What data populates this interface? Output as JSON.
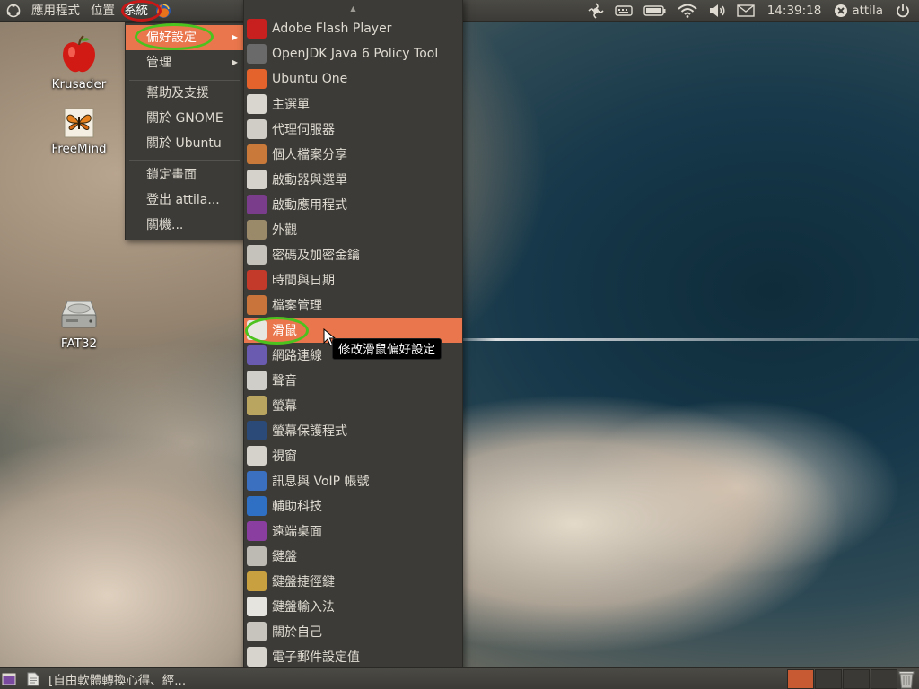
{
  "top_panel": {
    "menus": [
      {
        "label": "應用程式"
      },
      {
        "label": "位置"
      },
      {
        "label": "系統"
      }
    ],
    "clock": "14:39:18",
    "user": "attila",
    "indicators": [
      "touch-indicator-icon",
      "keyboard-icon",
      "battery-icon",
      "wifi-icon",
      "volume-icon",
      "mail-icon",
      "user-status-icon",
      "power-icon"
    ]
  },
  "desktop": {
    "icons": [
      {
        "label": "Krusader",
        "icon": "krusader-apple-icon"
      },
      {
        "label": "FreeMind",
        "icon": "freemind-butterfly-icon"
      },
      {
        "label": "FAT32",
        "icon": "drive-icon"
      }
    ]
  },
  "system_menu": {
    "items": [
      {
        "label": "偏好設定",
        "submenu": true,
        "active": true
      },
      {
        "label": "管理",
        "submenu": true
      },
      {
        "label": "幫助及支援"
      },
      {
        "label": "關於 GNOME"
      },
      {
        "label": "關於 Ubuntu"
      },
      {
        "label": "鎖定畫面"
      },
      {
        "label": "登出 attila..."
      },
      {
        "label": "關機..."
      }
    ]
  },
  "preferences_menu": {
    "items": [
      {
        "label": "Adobe Flash Player",
        "icon": "flash-icon",
        "color": "#c8201e"
      },
      {
        "label": "OpenJDK Java 6 Policy Tool",
        "icon": "java-icon",
        "color": "#6a6a6a"
      },
      {
        "label": "Ubuntu One",
        "icon": "ubuntu-one-icon",
        "color": "#e4622b"
      },
      {
        "label": "主選單",
        "icon": "main-menu-icon",
        "color": "#d8d6cf"
      },
      {
        "label": "代理伺服器",
        "icon": "proxy-icon",
        "color": "#cfcdc6"
      },
      {
        "label": "個人檔案分享",
        "icon": "file-share-icon",
        "color": "#c97a3a"
      },
      {
        "label": "啟動器與選單",
        "icon": "launcher-icon",
        "color": "#d4d2cb"
      },
      {
        "label": "啟動應用程式",
        "icon": "startup-apps-icon",
        "color": "#7a3d8c"
      },
      {
        "label": "外觀",
        "icon": "appearance-icon",
        "color": "#9a8a6a"
      },
      {
        "label": "密碼及加密金鑰",
        "icon": "keys-icon",
        "color": "#c4c2bb"
      },
      {
        "label": "時間與日期",
        "icon": "clock-calendar-icon",
        "color": "#c33a2a"
      },
      {
        "label": "檔案管理",
        "icon": "file-manager-icon",
        "color": "#c9743a"
      },
      {
        "label": "滑鼠",
        "icon": "mouse-icon",
        "color": "#e8e6e1",
        "hover": true
      },
      {
        "label": "網路連線",
        "icon": "network-icon",
        "color": "#6a5ab0"
      },
      {
        "label": "聲音",
        "icon": "sound-icon",
        "color": "#d0cec8"
      },
      {
        "label": "螢幕",
        "icon": "display-icon",
        "color": "#b9a460"
      },
      {
        "label": "螢幕保護程式",
        "icon": "screensaver-icon",
        "color": "#2b4a78"
      },
      {
        "label": "視窗",
        "icon": "windows-icon",
        "color": "#d4d2cb"
      },
      {
        "label": "訊息與 VoIP 帳號",
        "icon": "im-accounts-icon",
        "color": "#3b6fc0"
      },
      {
        "label": "輔助科技",
        "icon": "accessibility-icon",
        "color": "#2f6fc4"
      },
      {
        "label": "遠端桌面",
        "icon": "remote-desktop-icon",
        "color": "#8a3fa0"
      },
      {
        "label": "鍵盤",
        "icon": "keyboard-icon",
        "color": "#bcbab3"
      },
      {
        "label": "鍵盤捷徑鍵",
        "icon": "keyboard-shortcuts-icon",
        "color": "#c8a040"
      },
      {
        "label": "鍵盤輸入法",
        "icon": "input-method-icon",
        "color": "#e6e4de"
      },
      {
        "label": "關於自己",
        "icon": "about-me-icon",
        "color": "#c6c4bd"
      },
      {
        "label": "電子郵件設定值",
        "icon": "email-settings-icon",
        "color": "#d6d4cd"
      }
    ]
  },
  "tooltip": {
    "text": "修改滑鼠偏好設定"
  },
  "bottom_panel": {
    "task": "[自由軟體轉換心得、經...",
    "workspaces": 4,
    "active_workspace": 1
  }
}
